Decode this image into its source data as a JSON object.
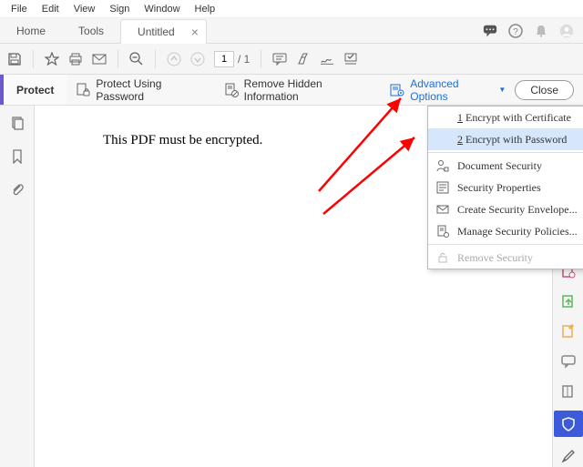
{
  "menubar": [
    "File",
    "Edit",
    "View",
    "Sign",
    "Window",
    "Help"
  ],
  "tabs": {
    "home": "Home",
    "tools": "Tools",
    "doc": "Untitled"
  },
  "toolbar": {
    "page_current": "1",
    "page_total": "/ 1"
  },
  "protect": {
    "label": "Protect",
    "using_password": "Protect Using Password",
    "remove_hidden": "Remove Hidden Information",
    "advanced": "Advanced Options",
    "close": "Close"
  },
  "document": {
    "body": "This PDF must be encrypted."
  },
  "dropdown": {
    "encrypt_cert": "Encrypt with Certificate",
    "encrypt_cert_ul": "1",
    "encrypt_pwd": "Encrypt with Password",
    "encrypt_pwd_ul": "2",
    "doc_security": "Document Security",
    "sec_props": "Security Properties",
    "envelope": "Create Security Envelope...",
    "policies": "Manage Security Policies...",
    "remove_sec": "Remove Security"
  }
}
